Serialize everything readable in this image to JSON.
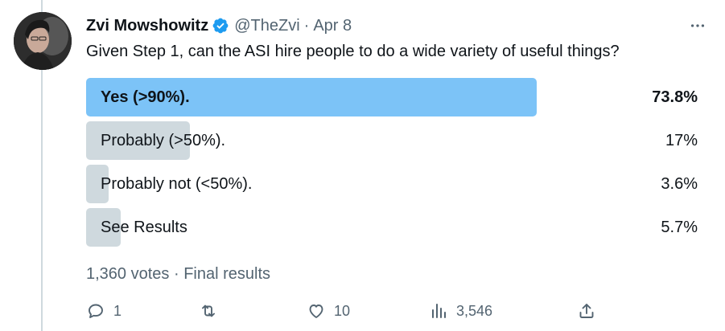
{
  "tweet": {
    "author_name": "Zvi Mowshowitz",
    "handle": "@TheZvi",
    "separator": "·",
    "date": "Apr 8",
    "text": "Given Step 1, can the ASI hire people to do a wide variety of useful things?"
  },
  "poll": {
    "options": [
      {
        "label": "Yes (>90%).",
        "percent": "73.8%",
        "share": 0.738,
        "winner": true
      },
      {
        "label": "Probably (>50%).",
        "percent": "17%",
        "share": 0.17,
        "winner": false
      },
      {
        "label": "Probably not (<50%).",
        "percent": "3.6%",
        "share": 0.036,
        "winner": false
      },
      {
        "label": "See Results",
        "percent": "5.7%",
        "share": 0.057,
        "winner": false
      }
    ],
    "votes": "1,360 votes",
    "separator": "·",
    "status": "Final results"
  },
  "actions": {
    "replies": "1",
    "likes": "10",
    "views": "3,546"
  },
  "colors": {
    "winner_bar": "#7cc3f7",
    "option_bar": "#cfd9de",
    "verified": "#1d9bf0",
    "muted_text": "#536471"
  },
  "icons": [
    "verified-badge-icon",
    "more-icon",
    "reply-icon",
    "retweet-icon",
    "like-icon",
    "views-icon",
    "share-icon"
  ]
}
